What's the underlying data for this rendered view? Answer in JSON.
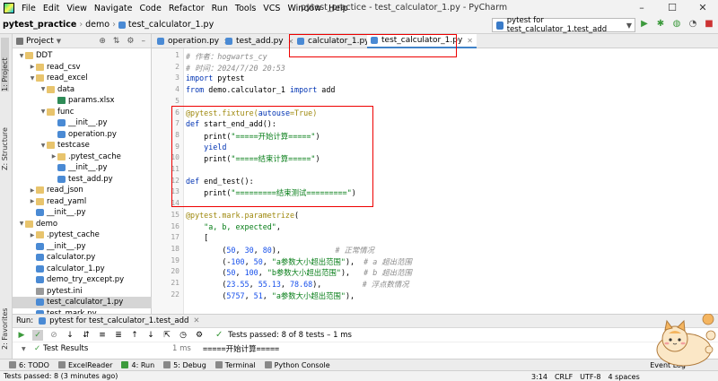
{
  "menubar": {
    "items": [
      "File",
      "Edit",
      "View",
      "Navigate",
      "Code",
      "Refactor",
      "Run",
      "Tools",
      "VCS",
      "Window",
      "Help"
    ],
    "title": "pytest_practice - test_calculator_1.py - PyCharm"
  },
  "navbar": {
    "crumbs": [
      "pytest_practice",
      "demo",
      "test_calculator_1.py"
    ],
    "run_config": "pytest for test_calculator_1.test_add"
  },
  "sidebar_tabs": {
    "project": "1: Project",
    "structure": "Z: Structure",
    "favorites": "2: Favorites"
  },
  "project": {
    "title": "Project",
    "tree": [
      {
        "label": "DDT",
        "kind": "folder",
        "depth": 0,
        "arrow": "down"
      },
      {
        "label": "read_csv",
        "kind": "folder",
        "depth": 1,
        "arrow": "right"
      },
      {
        "label": "read_excel",
        "kind": "folder",
        "depth": 1,
        "arrow": "down"
      },
      {
        "label": "data",
        "kind": "folder",
        "depth": 2,
        "arrow": "down"
      },
      {
        "label": "params.xlsx",
        "kind": "xls",
        "depth": 3,
        "arrow": ""
      },
      {
        "label": "func",
        "kind": "folder",
        "depth": 2,
        "arrow": "down"
      },
      {
        "label": "__init__.py",
        "kind": "py",
        "depth": 3,
        "arrow": ""
      },
      {
        "label": "operation.py",
        "kind": "py",
        "depth": 3,
        "arrow": ""
      },
      {
        "label": "testcase",
        "kind": "folder",
        "depth": 2,
        "arrow": "down"
      },
      {
        "label": ".pytest_cache",
        "kind": "folder",
        "depth": 3,
        "arrow": "right"
      },
      {
        "label": "__init__.py",
        "kind": "py",
        "depth": 3,
        "arrow": ""
      },
      {
        "label": "test_add.py",
        "kind": "py",
        "depth": 3,
        "arrow": ""
      },
      {
        "label": "read_json",
        "kind": "folder",
        "depth": 1,
        "arrow": "right"
      },
      {
        "label": "read_yaml",
        "kind": "folder",
        "depth": 1,
        "arrow": "right"
      },
      {
        "label": "__init__.py",
        "kind": "py",
        "depth": 1,
        "arrow": ""
      },
      {
        "label": "demo",
        "kind": "folder",
        "depth": 0,
        "arrow": "down"
      },
      {
        "label": ".pytest_cache",
        "kind": "folder",
        "depth": 1,
        "arrow": "right"
      },
      {
        "label": "__init__.py",
        "kind": "py",
        "depth": 1,
        "arrow": ""
      },
      {
        "label": "calculator.py",
        "kind": "py",
        "depth": 1,
        "arrow": ""
      },
      {
        "label": "calculator_1.py",
        "kind": "py",
        "depth": 1,
        "arrow": ""
      },
      {
        "label": "demo_try_except.py",
        "kind": "py",
        "depth": 1,
        "arrow": ""
      },
      {
        "label": "pytest.ini",
        "kind": "ini",
        "depth": 1,
        "arrow": ""
      },
      {
        "label": "test_calculator_1.py",
        "kind": "py",
        "depth": 1,
        "arrow": "",
        "selected": true
      },
      {
        "label": "test_mark.py",
        "kind": "py",
        "depth": 1,
        "arrow": ""
      }
    ]
  },
  "editor": {
    "tabs": [
      {
        "label": "operation.py",
        "active": false
      },
      {
        "label": "test_add.py",
        "active": false
      },
      {
        "label": "calculator_1.py",
        "active": false
      },
      {
        "label": "test_calculator_1.py",
        "active": true
      }
    ],
    "lines": [
      [
        [
          "c-comment",
          "# 作者：hogwarts_cy"
        ]
      ],
      [
        [
          "c-comment",
          "# 时间：2024/7/20 20:53"
        ]
      ],
      [
        [
          "c-kw",
          "import"
        ],
        [
          "c-def",
          " pytest"
        ]
      ],
      [
        [
          "c-kw",
          "from"
        ],
        [
          "c-def",
          " demo.calculator_1 "
        ],
        [
          "c-kw",
          "import"
        ],
        [
          "c-def",
          " add"
        ]
      ],
      [
        [
          "c-def",
          ""
        ]
      ],
      [
        [
          "c-deco",
          "@pytest.fixture("
        ],
        [
          "c-kw",
          "autouse"
        ],
        [
          "c-deco",
          "=True)"
        ]
      ],
      [
        [
          "c-kw",
          "def"
        ],
        [
          "c-def",
          " start_end_add():"
        ]
      ],
      [
        [
          "c-def",
          "    print("
        ],
        [
          "c-str",
          "\"=====开始计算=====\""
        ],
        [
          "c-def",
          ")"
        ]
      ],
      [
        [
          "c-def",
          "    "
        ],
        [
          "c-kw",
          "yield"
        ]
      ],
      [
        [
          "c-def",
          "    print("
        ],
        [
          "c-str",
          "\"=====结束计算=====\""
        ],
        [
          "c-def",
          ")"
        ]
      ],
      [
        [
          "c-def",
          ""
        ]
      ],
      [
        [
          "c-kw",
          "def"
        ],
        [
          "c-def",
          " end_test():"
        ]
      ],
      [
        [
          "c-def",
          "    print("
        ],
        [
          "c-str",
          "\"=========结束测试=========\""
        ],
        [
          "c-def",
          ")"
        ]
      ],
      [
        [
          "c-def",
          ""
        ]
      ],
      [
        [
          "c-deco",
          "@pytest.mark.parametrize"
        ],
        [
          "c-def",
          "("
        ]
      ],
      [
        [
          "c-def",
          "    "
        ],
        [
          "c-str",
          "\"a, b, expected\""
        ],
        [
          "c-def",
          ","
        ]
      ],
      [
        [
          "c-def",
          "    ["
        ]
      ],
      [
        [
          "c-def",
          "        ("
        ],
        [
          "c-num",
          "50"
        ],
        [
          "c-def",
          ", "
        ],
        [
          "c-num",
          "30"
        ],
        [
          "c-def",
          ", "
        ],
        [
          "c-num",
          "80"
        ],
        [
          "c-def",
          "),            "
        ],
        [
          "c-comment",
          "# 正常情况"
        ]
      ],
      [
        [
          "c-def",
          "        (-"
        ],
        [
          "c-num",
          "100"
        ],
        [
          "c-def",
          ", "
        ],
        [
          "c-num",
          "50"
        ],
        [
          "c-def",
          ", "
        ],
        [
          "c-str",
          "\"a参数大小超出范围\""
        ],
        [
          "c-def",
          "),  "
        ],
        [
          "c-comment",
          "# a 超出范围"
        ]
      ],
      [
        [
          "c-def",
          "        ("
        ],
        [
          "c-num",
          "50"
        ],
        [
          "c-def",
          ", "
        ],
        [
          "c-num",
          "100"
        ],
        [
          "c-def",
          ", "
        ],
        [
          "c-str",
          "\"b参数大小超出范围\""
        ],
        [
          "c-def",
          "),   "
        ],
        [
          "c-comment",
          "# b 超出范围"
        ]
      ],
      [
        [
          "c-def",
          "        ("
        ],
        [
          "c-num",
          "23.55"
        ],
        [
          "c-def",
          ", "
        ],
        [
          "c-num",
          "55.13"
        ],
        [
          "c-def",
          ", "
        ],
        [
          "c-num",
          "78.68"
        ],
        [
          "c-def",
          "),         "
        ],
        [
          "c-comment",
          "# 浮点数情况"
        ]
      ],
      [
        [
          "c-def",
          "        ("
        ],
        [
          "c-num",
          "5757"
        ],
        [
          "c-def",
          ", "
        ],
        [
          "c-num",
          "51"
        ],
        [
          "c-def",
          ", "
        ],
        [
          "c-str",
          "\"a参数大小超出范围\""
        ],
        [
          "c-def",
          "),"
        ]
      ]
    ],
    "line_numbers": [
      "1",
      "2",
      "3",
      "4",
      "5",
      "6",
      "7",
      "8",
      "9",
      "10",
      "11",
      "12",
      "13",
      "14",
      "15",
      "16",
      "17",
      "18",
      "19",
      "20",
      "21",
      "22"
    ]
  },
  "run": {
    "label": "Run:",
    "tab": "pytest for test_calculator_1.test_add",
    "status": "Tests passed: 8 of 8 tests – 1 ms",
    "results_label": "Test Results",
    "results_time": "1 ms",
    "output": "=====开始计算====="
  },
  "bottom_tools": [
    {
      "label": "6: TODO",
      "active": false
    },
    {
      "label": "ExcelReader",
      "active": false
    },
    {
      "label": "4: Run",
      "active": true
    },
    {
      "label": "5: Debug",
      "active": false
    },
    {
      "label": "Terminal",
      "active": false
    },
    {
      "label": "Python Console",
      "active": false
    }
  ],
  "event_log": "Event Log",
  "statusbar": {
    "message": "Tests passed: 8 (3 minutes ago)",
    "position": "3:14",
    "line_sep": "CRLF",
    "encoding": "UTF-8",
    "indent": "4 spaces"
  },
  "colors": {
    "accent": "#4083c9",
    "highlight_box": "#e00000",
    "pass_green": "#3c9a3c"
  }
}
